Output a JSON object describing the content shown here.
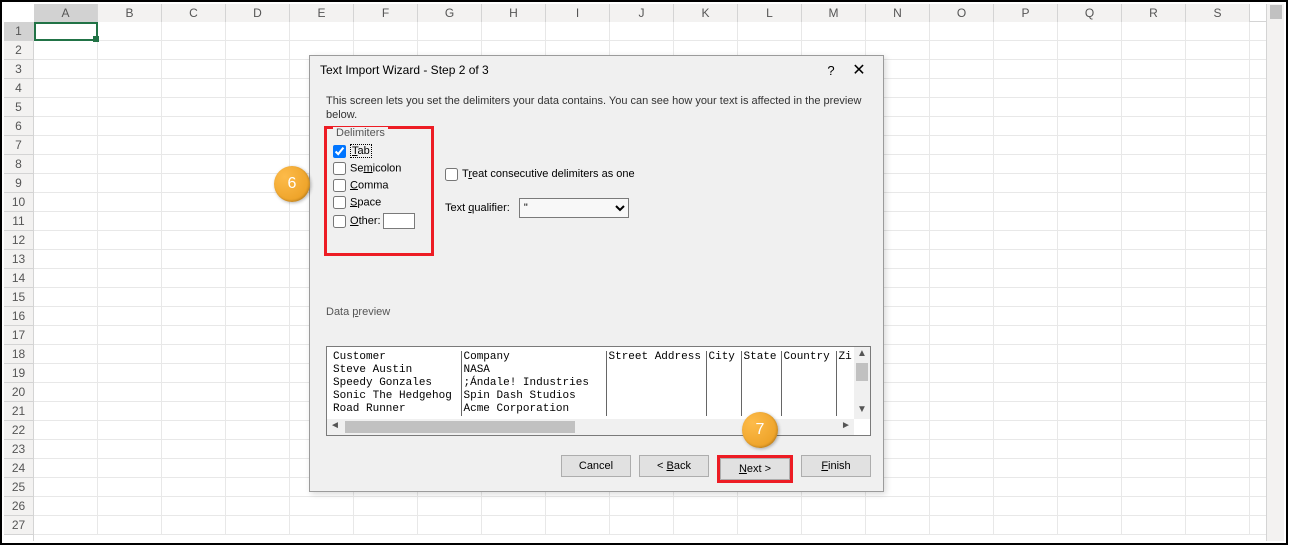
{
  "columns": [
    "A",
    "B",
    "C",
    "D",
    "E",
    "F",
    "G",
    "H",
    "I",
    "J",
    "K",
    "L",
    "M",
    "N",
    "O",
    "P",
    "Q",
    "R",
    "S"
  ],
  "row_count": 27,
  "dialog": {
    "title": "Text Import Wizard - Step 2 of 3",
    "description": "This screen lets you set the delimiters your data contains.  You can see how your text is affected in the preview below.",
    "delimiters_legend": "Delimiters",
    "tab_label": "Tab",
    "semicolon_label": "Semicolon",
    "comma_label": "Comma",
    "space_label": "Space",
    "other_label": "Other:",
    "treat_label": "Treat consecutive delimiters as one",
    "qualifier_label": "Text qualifier:",
    "qualifier_value": "\"",
    "preview_label": "Data preview",
    "cancel": "Cancel",
    "back": "< Back",
    "next": "Next >",
    "finish": "Finish"
  },
  "callouts": {
    "a": "6",
    "b": "7"
  },
  "preview": {
    "headers": [
      "Customer",
      "Company",
      "Street Address",
      "City",
      "State",
      "Country",
      "Zi"
    ],
    "rows": [
      [
        "Steve Austin",
        "NASA",
        "",
        "",
        "",
        "",
        ""
      ],
      [
        "Speedy Gonzales",
        ";Ándale! Industries",
        "",
        "",
        "",
        "",
        ""
      ],
      [
        "Sonic The Hedgehog",
        "Spin Dash Studios",
        "",
        "",
        "",
        "",
        ""
      ],
      [
        "Road Runner",
        "Acme Corporation",
        "",
        "",
        "",
        "",
        ""
      ]
    ]
  }
}
